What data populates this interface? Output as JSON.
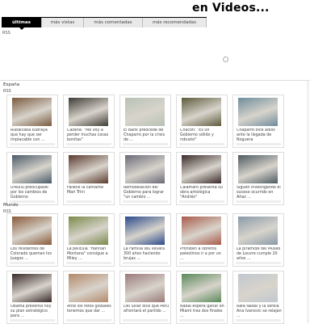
{
  "header": {
    "title": "en Videos..."
  },
  "tabs": [
    {
      "label": "últimas"
    },
    {
      "label": "más vistas"
    },
    {
      "label": "más comentadas"
    },
    {
      "label": "más recomendadas"
    }
  ],
  "top_rss": "RSS",
  "sections": [
    {
      "label": "España",
      "rss": "RSS",
      "items": [
        {
          "caption": "Rubalcaba subraya que hay que ser implacable con ...",
          "thumb_color": "#7a5a3e"
        },
        {
          "caption": "Cazaña: \"Me voy a perder muchas cosas bonitas\"",
          "thumb_color": "#3e3a35"
        },
        {
          "caption": "El Bank preocede de Chaparro por la crisis de ...",
          "thumb_color": "#b8c2b4"
        },
        {
          "caption": "Chacón: \"Es un Gobierno sólido y robusto\"",
          "thumb_color": "#5d5a3c"
        },
        {
          "caption": "Chaparro dice adiós ante la llegada de Noguera",
          "thumb_color": "#6e8c9c"
        },
        {
          "caption": "Urkullu preocupado por los cambios de Gobierno",
          "thumb_color": "#4a5a6a"
        },
        {
          "caption": "Fallece la cantante Mari Trini",
          "thumb_color": "#5a3a2e"
        },
        {
          "caption": "Remodelación del Gobierno para lograr \"un cambio ...",
          "thumb_color": "#6a6a78"
        },
        {
          "caption": "Calamaro presenta su obra antológica \"Andrés\"",
          "thumb_color": "#3a2a2a"
        },
        {
          "caption": "Siguen investigando el suceso ocurrido en Añaz ...",
          "thumb_color": "#4e5a62"
        }
      ]
    },
    {
      "label": "Mundo",
      "rss": "RSS",
      "items": [
        {
          "caption": "Los residentes de Colorado queman los Juegos ...",
          "thumb_color": "#8a5a3a"
        },
        {
          "caption": "La película \"Hannah Montana\" consigue a Miley ...",
          "thumb_color": "#7a8a4a"
        },
        {
          "caption": "La Familia Wu llevará 300 años haciendo brujas ...",
          "thumb_color": "#2a4a8a"
        },
        {
          "caption": "Prohíben a obreros palestinos ir a por un ...",
          "thumb_color": "#a85a4a"
        },
        {
          "caption": "La pirámide del Museo de Louvre cumple 20 años ...",
          "thumb_color": "#8a9aa8"
        },
        {
          "caption": "Obama presenta hoy su plan estratégico para ...",
          "thumb_color": "#3a2a2a"
        },
        {
          "caption": "Ante los retos globales tenemos que dar ...",
          "thumb_color": "#b48a6a"
        },
        {
          "caption": "Del Sólar dice que Perú afrontará el partido ...",
          "thumb_color": "#9a7a7a"
        },
        {
          "caption": "Nadal espera ganar en Miami tras dos finales ...",
          "thumb_color": "#5a8a5a"
        },
        {
          "caption": "Rafa Nadal y la serbia Ana Ivanovic se relajan ...",
          "thumb_color": "#c0c8d0"
        }
      ]
    }
  ]
}
